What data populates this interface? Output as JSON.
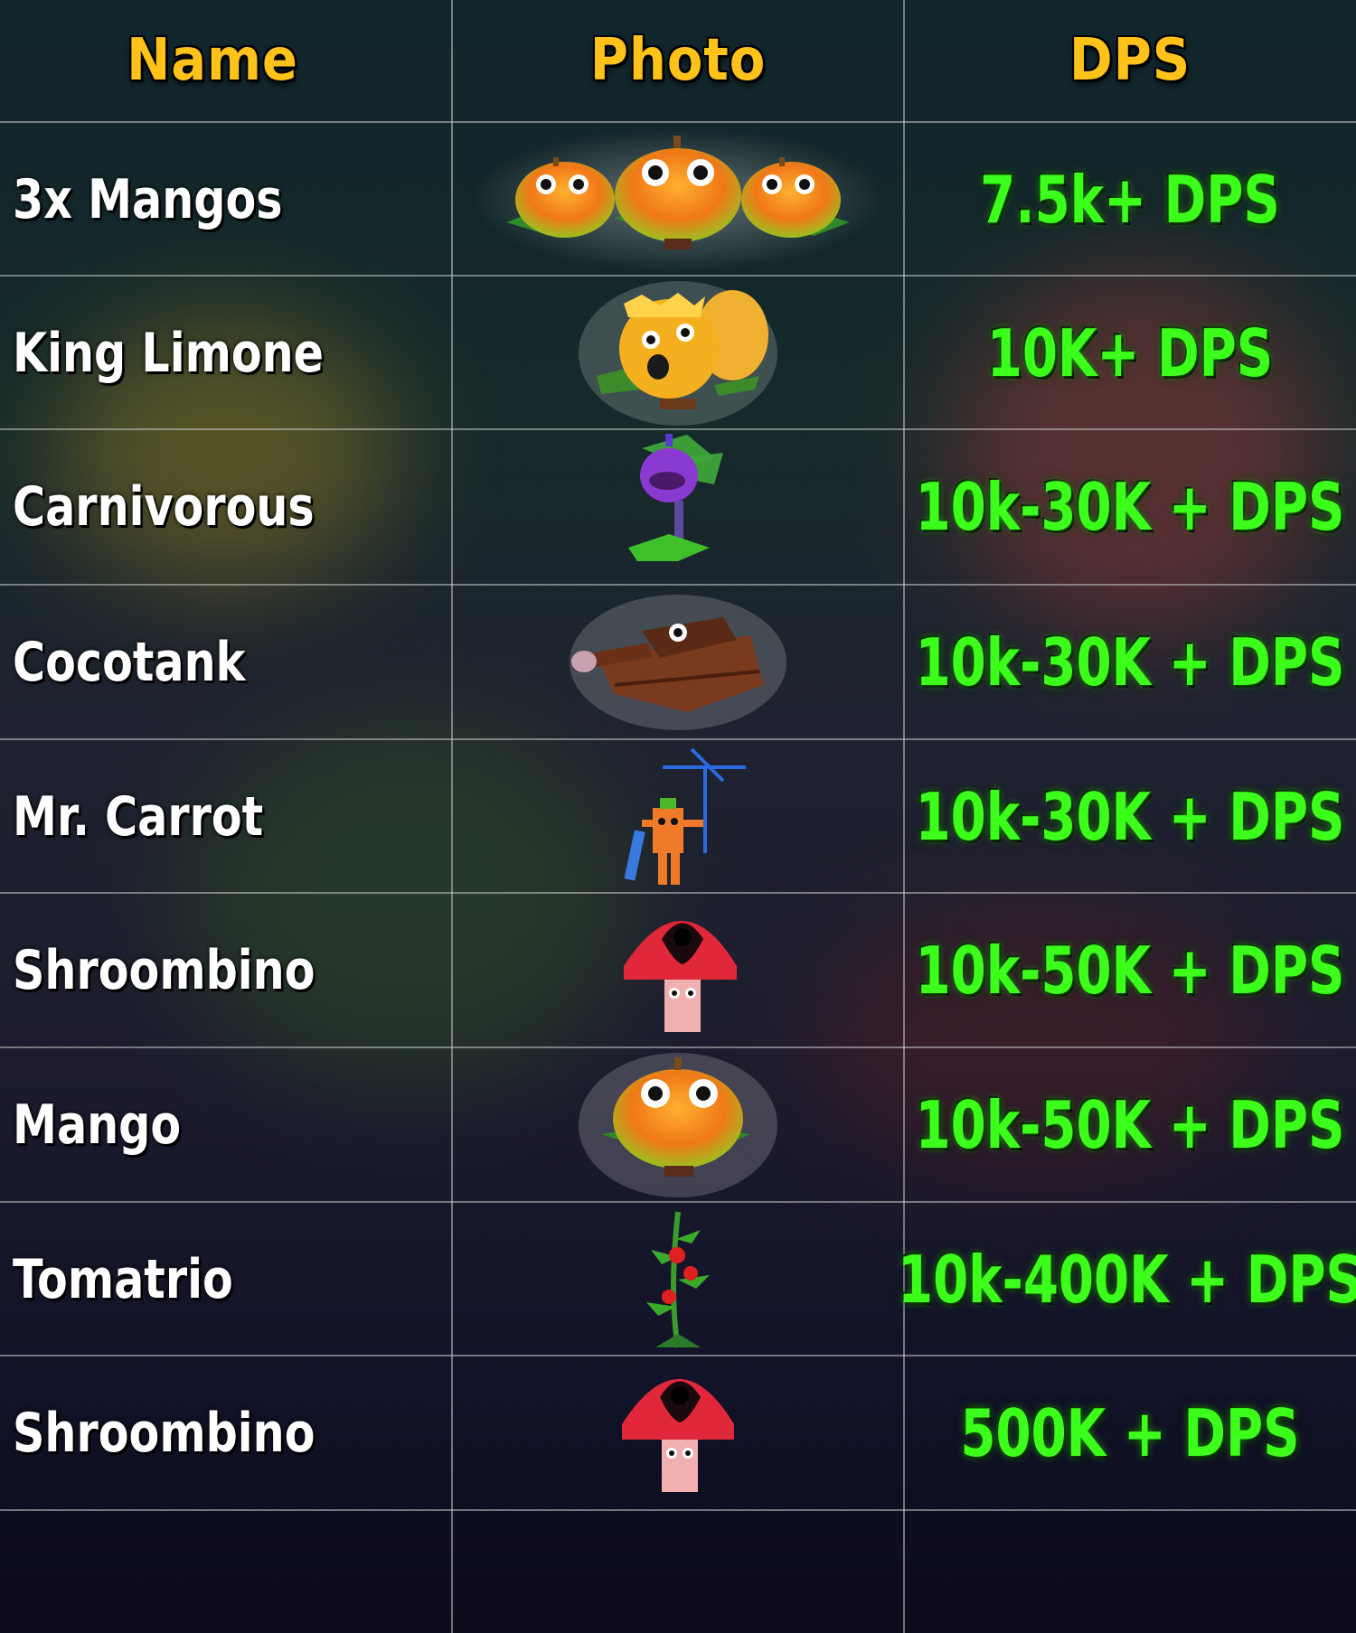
{
  "headers": {
    "name": "Name",
    "photo": "Photo",
    "dps": "DPS"
  },
  "rows": [
    {
      "name": "3x Mangos",
      "dps": "7.5k+ DPS",
      "icon": "triple-mango-icon"
    },
    {
      "name": "King Limone",
      "dps": "10K+ DPS",
      "icon": "king-limone-icon"
    },
    {
      "name": "Carnivorous",
      "dps": "10k-30K + DPS",
      "icon": "carnivorous-plant-icon"
    },
    {
      "name": "Cocotank",
      "dps": "10k-30K + DPS",
      "icon": "cocotank-icon"
    },
    {
      "name": "Mr. Carrot",
      "dps": "10k-30K + DPS",
      "icon": "carrot-icon"
    },
    {
      "name": "Shroombino",
      "dps": "10k-50K + DPS",
      "icon": "mushroom-icon"
    },
    {
      "name": "Mango",
      "dps": "10k-50K + DPS",
      "icon": "mango-icon"
    },
    {
      "name": "Tomatrio",
      "dps": "10k-400K + DPS",
      "icon": "tomato-plant-icon"
    },
    {
      "name": "Shroombino",
      "dps": "500K + DPS",
      "icon": "mushroom-icon"
    }
  ],
  "colors": {
    "header": "#ffc21a",
    "dps": "#3dff1c",
    "name": "#ffffff"
  }
}
